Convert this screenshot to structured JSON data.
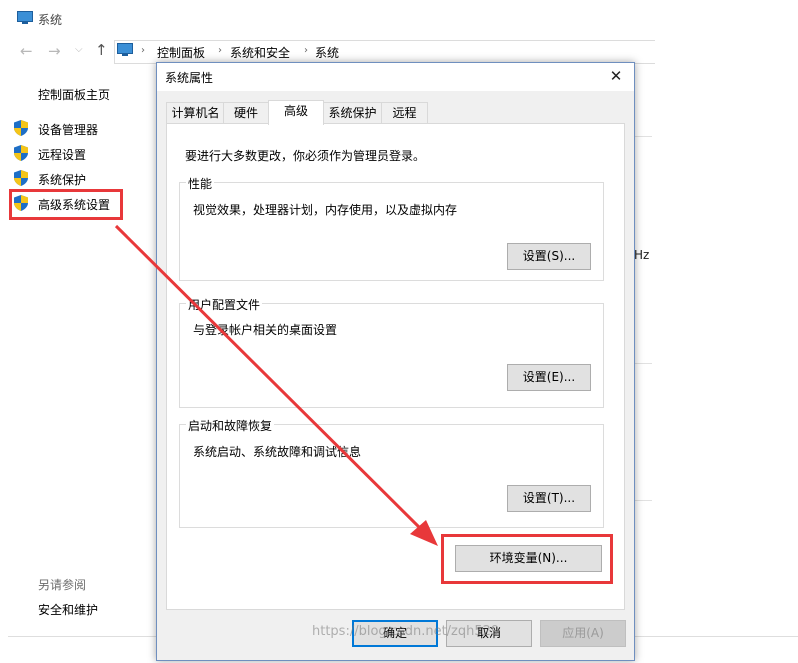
{
  "background_window": {
    "title": "系统",
    "breadcrumbs": [
      "控制面板",
      "系统和安全",
      "系统"
    ],
    "left_nav": {
      "home": "控制面板主页",
      "items": [
        {
          "label": "设备管理器",
          "icon": "shield-icon"
        },
        {
          "label": "远程设置",
          "icon": "shield-icon"
        },
        {
          "label": "系统保护",
          "icon": "shield-icon"
        },
        {
          "label": "高级系统设置",
          "icon": "shield-icon"
        }
      ],
      "see_also_title": "另请参阅",
      "see_also_items": [
        "安全和维护"
      ]
    },
    "partial_text": "Hz"
  },
  "dialog": {
    "title": "系统属性",
    "close_glyph": "✕",
    "tabs": [
      "计算机名",
      "硬件",
      "高级",
      "系统保护",
      "远程"
    ],
    "active_tab": "高级",
    "admin_note": "要进行大多数更改，你必须作为管理员登录。",
    "groups": [
      {
        "label": "性能",
        "desc": "视觉效果，处理器计划，内存使用，以及虚拟内存",
        "button": "设置(S)..."
      },
      {
        "label": "用户配置文件",
        "desc": "与登录帐户相关的桌面设置",
        "button": "设置(E)..."
      },
      {
        "label": "启动和故障恢复",
        "desc": "系统启动、系统故障和调试信息",
        "button": "设置(T)..."
      }
    ],
    "env_button": "环境变量(N)...",
    "ok_button": "确定",
    "cancel_button": "取消",
    "apply_button": "应用(A)"
  },
  "annotation": {
    "highlight_color": "#e8383a"
  },
  "watermark": "https://blog.csdn.net/zqh529"
}
